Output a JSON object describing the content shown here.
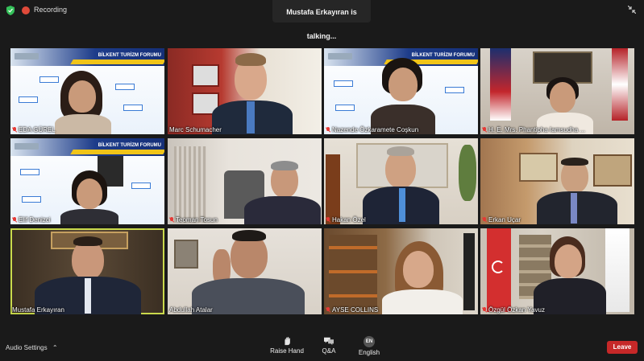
{
  "topbar": {
    "recording_label": "Recording",
    "talking_text": "Mustafa Erkayıran is talking..."
  },
  "slide_header": "BİLKENT TURİZM FORUMU",
  "participants": [
    {
      "name": "EDA GÜREL",
      "muted": true
    },
    {
      "name": "Marc Schumacher",
      "muted": false
    },
    {
      "name": "Nazende Özkaramete Coşkun",
      "muted": true
    },
    {
      "name": "H. E. Mrs. Phantipha Iamsudha ...",
      "muted": true
    },
    {
      "name": "Elif Denizci",
      "muted": true
    },
    {
      "name": "Teoman Tosun",
      "muted": true
    },
    {
      "name": "Hakan Özel",
      "muted": true
    },
    {
      "name": "Erkan Uçar",
      "muted": true
    },
    {
      "name": "Mustafa Erkayıran",
      "muted": false
    },
    {
      "name": "Abdullah Atalar",
      "muted": false
    },
    {
      "name": "AYSE COLLINS",
      "muted": true
    },
    {
      "name": "Özgül Özkan Yavuz",
      "muted": true
    }
  ],
  "bottombar": {
    "audio_settings": "Audio Settings",
    "raise_hand": "Raise Hand",
    "qa": "Q&A",
    "language_badge": "EN",
    "language": "English",
    "leave": "Leave"
  },
  "colors": {
    "active_speaker_outline": "#c9d94c",
    "leave_button": "#c62828",
    "muted_icon": "#e53935",
    "recording_dot": "#e04a3a"
  }
}
